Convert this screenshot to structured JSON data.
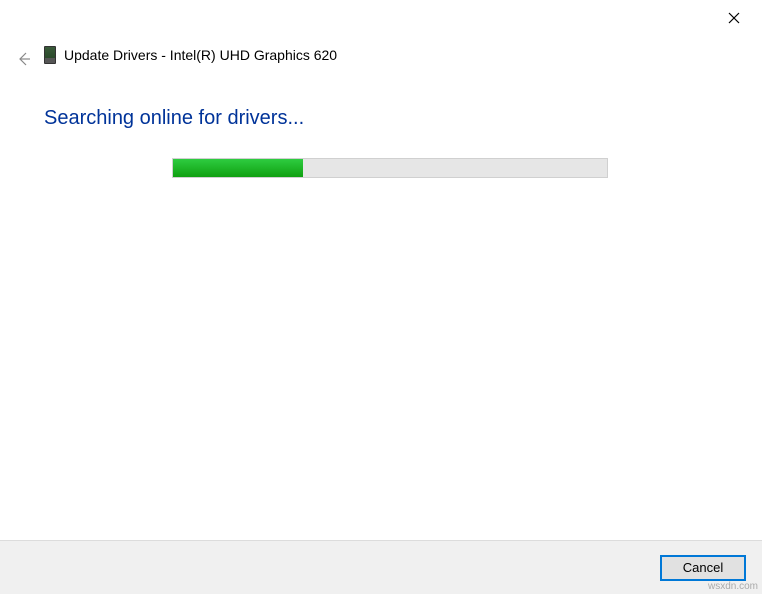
{
  "header": {
    "title": "Update Drivers - Intel(R) UHD Graphics 620"
  },
  "status": {
    "message": "Searching online for drivers..."
  },
  "progress": {
    "percent": 30
  },
  "footer": {
    "cancel_label": "Cancel"
  },
  "watermark": "wsxdn.com"
}
